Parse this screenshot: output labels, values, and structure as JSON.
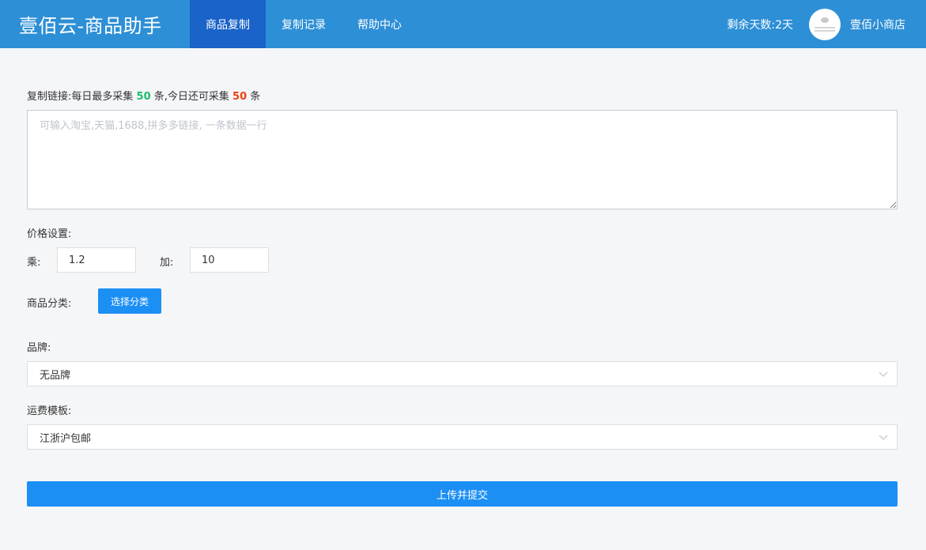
{
  "header": {
    "brand": "壹佰云-商品助手",
    "nav": [
      {
        "label": "商品复制",
        "active": true
      },
      {
        "label": "复制记录",
        "active": false
      },
      {
        "label": "帮助中心",
        "active": false
      }
    ],
    "days_left": "剩余天数:2天",
    "shop_name": "壹佰小商店",
    "colors": {
      "bar": "#2d8fd6",
      "active_tab": "#1a63c9"
    }
  },
  "copy_link": {
    "label_prefix": "复制链接:每日最多采集",
    "daily_max": "50",
    "label_mid": "条,今日还可采集",
    "remaining": "50",
    "label_suffix": "条",
    "placeholder": "可输入淘宝,天猫,1688,拼多多链接, 一条数据一行",
    "value": ""
  },
  "price": {
    "label": "价格设置:",
    "multiply_label": "乘:",
    "multiply_value": "1.2",
    "add_label": "加:",
    "add_value": "10"
  },
  "category": {
    "label": "商品分类:",
    "button": "选择分类"
  },
  "brand_field": {
    "label": "品牌:",
    "selected": "无品牌"
  },
  "shipping": {
    "label": "运费模板:",
    "selected": "江浙沪包邮"
  },
  "submit_label": "上传并提交",
  "colors": {
    "primary": "#1c8ff5",
    "green": "#19be6b",
    "red": "#ed4014"
  }
}
